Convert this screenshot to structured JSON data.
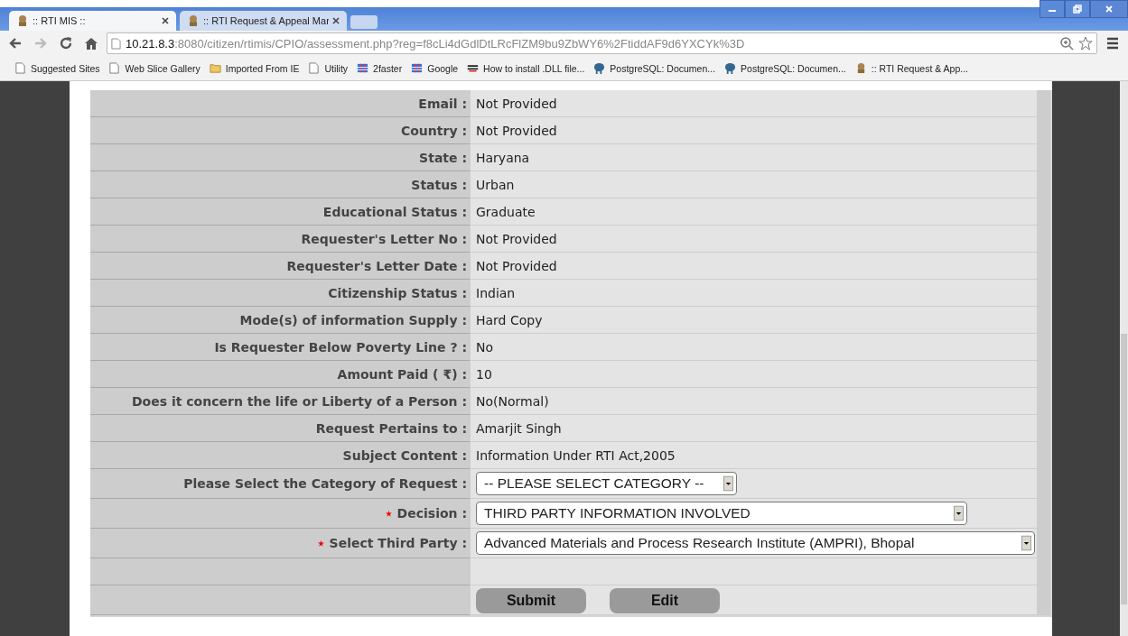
{
  "tabs": [
    {
      "title": ":: RTI MIS ::",
      "selected": true
    },
    {
      "title": ":: RTI Request & Appeal Mar",
      "selected": false
    }
  ],
  "address": {
    "host": "10.21.8.3",
    "rest": ":8080/citizen/rtimis/CPIO/assessment.php?reg=f8cLi4dGdlDtLRcFlZM9bu9ZbWY6%2FtiddAF9d6YXCYk%3D"
  },
  "bookmarks": [
    {
      "label": "Suggested Sites",
      "kind": "page"
    },
    {
      "label": "Web Slice Gallery",
      "kind": "page"
    },
    {
      "label": "Imported From IE",
      "kind": "folder"
    },
    {
      "label": "Utility",
      "kind": "page"
    },
    {
      "label": "2faster",
      "kind": "grid"
    },
    {
      "label": "Google",
      "kind": "grid"
    },
    {
      "label": "How to install .DLL file...",
      "kind": "dll"
    },
    {
      "label": "PostgreSQL: Documen...",
      "kind": "elephant"
    },
    {
      "label": "PostgreSQL: Documen...",
      "kind": "elephant"
    },
    {
      "label": ":: RTI Request & App...",
      "kind": "emblem"
    }
  ],
  "form": {
    "rows": [
      {
        "kind": "text",
        "label": "Email :",
        "value": "Not Provided"
      },
      {
        "kind": "text",
        "label": "Country :",
        "value": "Not Provided"
      },
      {
        "kind": "text",
        "label": "State :",
        "value": "Haryana"
      },
      {
        "kind": "text",
        "label": "Status :",
        "value": "Urban"
      },
      {
        "kind": "text",
        "label": "Educational Status :",
        "value": "Graduate"
      },
      {
        "kind": "text",
        "label": "Requester's Letter No :",
        "value": "Not Provided"
      },
      {
        "kind": "text",
        "label": "Requester's Letter Date :",
        "value": "Not Provided"
      },
      {
        "kind": "text",
        "label": "Citizenship Status :",
        "value": "Indian"
      },
      {
        "kind": "text",
        "label": "Mode(s) of information Supply :",
        "value": "Hard Copy"
      },
      {
        "kind": "text",
        "label": "Is Requester Below Poverty Line ? :",
        "value": "No"
      },
      {
        "kind": "text",
        "label": "Amount Paid ( ₹) :",
        "value": "10"
      },
      {
        "kind": "text",
        "label": "Does it concern the life or Liberty of a Person :",
        "value": "No(Normal)"
      },
      {
        "kind": "text",
        "label": "Request Pertains to :",
        "value": "Amarjit Singh"
      },
      {
        "kind": "text",
        "label": "Subject Content :",
        "value": "Information Under RTI Act,2005"
      },
      {
        "kind": "select",
        "label": "Please Select the Category of Request :",
        "value": "-- PLEASE SELECT CATEGORY --",
        "required": false
      },
      {
        "kind": "select",
        "label": "Decision :",
        "value": "THIRD PARTY INFORMATION INVOLVED",
        "required": true
      },
      {
        "kind": "select",
        "label": "Select Third Party :",
        "value": "Advanced Materials and Process Research Institute (AMPRI), Bhopal",
        "required": true
      }
    ],
    "buttons": [
      "Submit",
      "Edit"
    ]
  }
}
